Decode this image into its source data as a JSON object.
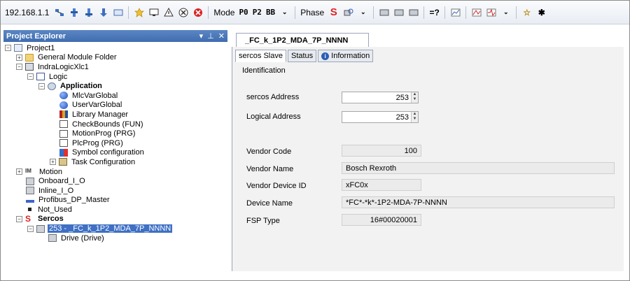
{
  "toolbar": {
    "ip": "192.168.1.1",
    "mode_label": "Mode",
    "mode_p0": "P0",
    "mode_p2": "P2",
    "mode_bb": "BB",
    "phase_label": "Phase",
    "icons": [
      "network-icon",
      "login-icon",
      "logout-icon",
      "run-icon",
      "stop-icon",
      "reset-icon",
      "help-icon"
    ]
  },
  "explorer": {
    "title": "Project Explorer",
    "items": [
      {
        "label": "Project1"
      },
      {
        "label": "General Module Folder"
      },
      {
        "label": "IndraLogicXlc1"
      },
      {
        "label": "Logic"
      },
      {
        "label": "Application"
      },
      {
        "label": "MlcVarGlobal"
      },
      {
        "label": "UserVarGlobal"
      },
      {
        "label": "Library Manager"
      },
      {
        "label": "CheckBounds (FUN)"
      },
      {
        "label": "MotionProg (PRG)"
      },
      {
        "label": "PlcProg (PRG)"
      },
      {
        "label": "Symbol configuration"
      },
      {
        "label": "Task Configuration"
      },
      {
        "label": "Motion"
      },
      {
        "label": "Onboard_I_O"
      },
      {
        "label": "Inline_I_O"
      },
      {
        "label": "Profibus_DP_Master"
      },
      {
        "label": "Not_Used"
      },
      {
        "label": "Sercos"
      },
      {
        "label": "253 - _FC_k_1P2_MDA_7P_NNNN"
      },
      {
        "label": "Drive (Drive)"
      }
    ]
  },
  "document": {
    "tab_title": "_FC_k_1P2_MDA_7P_NNNN",
    "subtabs": [
      "sercos Slave",
      "Status",
      "Information"
    ],
    "section_title": "Identification",
    "fields": {
      "sercos_address": {
        "label": "sercos Address",
        "value": "253"
      },
      "logical_address": {
        "label": "Logical Address",
        "value": "253"
      },
      "vendor_code": {
        "label": "Vendor Code",
        "value": "100"
      },
      "vendor_name": {
        "label": "Vendor Name",
        "value": "Bosch Rexroth"
      },
      "vendor_device_id": {
        "label": "Vendor Device ID",
        "value": "xFC0x"
      },
      "device_name": {
        "label": "Device Name",
        "value": "*FC*-*k*-1P2-MDA-7P-NNNN"
      },
      "fsp_type": {
        "label": "FSP Type",
        "value": "16#00020001"
      }
    }
  },
  "colors": {
    "header_blue": "#3f6db0",
    "selection_blue": "#3f70c4",
    "sercos_red": "#d22222"
  }
}
